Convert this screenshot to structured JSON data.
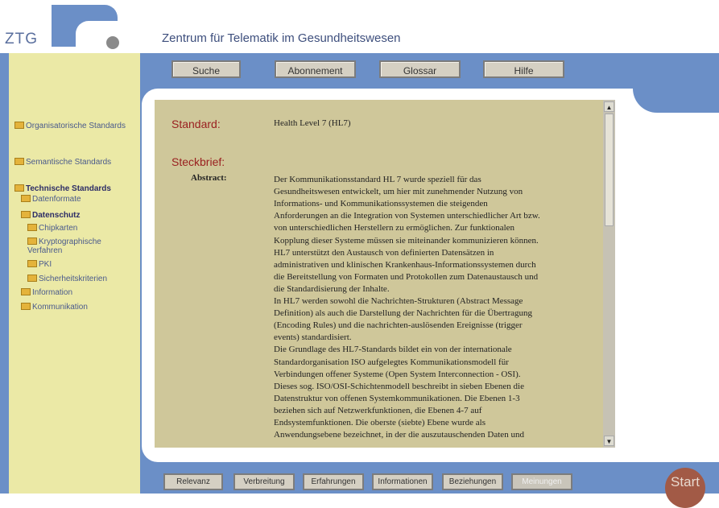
{
  "logo": {
    "text": "ZTG"
  },
  "header": {
    "title": "Zentrum für Telematik im Gesundheitswesen"
  },
  "top_nav": [
    {
      "label": "Suche"
    },
    {
      "label": "Abonnement"
    },
    {
      "label": "Glossar"
    },
    {
      "label": "Hilfe"
    }
  ],
  "sidebar": {
    "items": [
      {
        "label": "Organisatorische Standards"
      },
      {
        "label": "Semantische Standards"
      },
      {
        "label": "Technische Standards"
      },
      {
        "label": "Datenformate"
      },
      {
        "label": "Datenschutz"
      },
      {
        "label": "Chipkarten"
      },
      {
        "label": "Kryptographische Verfahren"
      },
      {
        "label": "PKI"
      },
      {
        "label": "Sicherheitskriterien"
      },
      {
        "label": "Information"
      },
      {
        "label": "Kommunikation"
      }
    ]
  },
  "content": {
    "standard_label": "Standard:",
    "standard_value": "Health Level 7 (HL7)",
    "steckbrief_label": "Steckbrief:",
    "abstract_label": "Abstract:",
    "abstract_lines": [
      "Der Kommunikationsstandard HL 7 wurde speziell für das",
      "Gesundheitswesen entwickelt, um hier mit zunehmender Nutzung von",
      "Informations- und Kommunikationssystemen die steigenden",
      "Anforderungen an die Integration von Systemen unterschiedlicher Art bzw.",
      "von unterschiedlichen Herstellern zu ermöglichen. Zur funktionalen",
      "Kopplung dieser Systeme müssen sie miteinander kommunizieren können.",
      "HL7 unterstützt den Austausch von definierten Datensätzen in",
      "administrativen und klinischen Krankenhaus-Informationssystemen durch",
      "die Bereitstellung von Formaten und Protokollen zum Datenaustausch und",
      "die Standardisierung der Inhalte.",
      "In HL7 werden sowohl die Nachrichten-Strukturen (Abstract Message",
      "Definition) als auch die Darstellung der Nachrichten für die Übertragung",
      "(Encoding Rules) und die nachrichten-auslösenden Ereignisse (trigger",
      "events) standardisiert.",
      "Die Grundlage des HL7-Standards bildet ein von der internationale",
      "Standardorganisation ISO aufgelegtes Kommunikationsmodell für",
      "Verbindungen offener Systeme (Open System Interconnection - OSI).",
      "Dieses sog. ISO/OSI-Schichtenmodell beschreibt in sieben Ebenen die",
      "Datenstruktur von offenen Systemkommunikationen. Die Ebenen 1-3",
      "beziehen sich auf Netzwerkfunktionen, die Ebenen 4-7 auf",
      "Endsystemfunktionen. Die oberste (siebte) Ebene wurde als",
      "Anwendungsebene bezeichnet, in der die auszutauschenden Daten und"
    ]
  },
  "bottom_nav": [
    {
      "label": "Relevanz"
    },
    {
      "label": "Verbreitung"
    },
    {
      "label": "Erfahrungen"
    },
    {
      "label": "Informationen"
    },
    {
      "label": "Beziehungen"
    },
    {
      "label": "Meinungen"
    }
  ],
  "start_button": {
    "label": "Start"
  },
  "colors": {
    "frame": "#6b8fc7",
    "sidebar": "#ebe9a6",
    "content": "#cfc79a",
    "accent_red": "#9a2020"
  }
}
